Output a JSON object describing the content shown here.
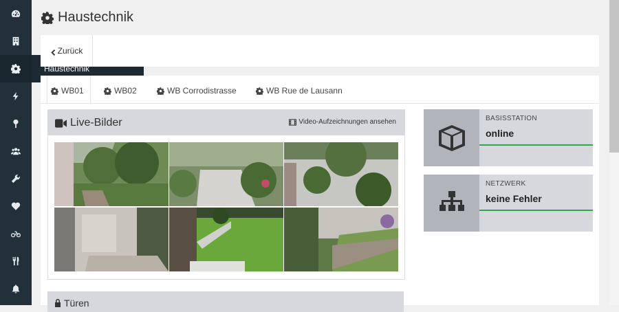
{
  "page": {
    "title": "Haustechnik"
  },
  "sidebar": {
    "items": [
      {
        "icon": "dashboard-icon"
      },
      {
        "icon": "building-icon"
      },
      {
        "icon": "gear-icon",
        "active": true
      },
      {
        "icon": "bolt-icon"
      },
      {
        "icon": "pin-icon"
      },
      {
        "icon": "users-icon"
      },
      {
        "icon": "wrench-icon"
      },
      {
        "icon": "heartbeat-icon"
      },
      {
        "icon": "bicycle-icon"
      },
      {
        "icon": "cutlery-icon"
      },
      {
        "icon": "bell-icon"
      }
    ],
    "flyout_label": "Haustechnik"
  },
  "back": {
    "label": "Zurück"
  },
  "tabs": [
    {
      "label": "WB01",
      "active": true
    },
    {
      "label": "WB02"
    },
    {
      "label": "WB Corrodistrasse"
    },
    {
      "label": "WB Rue de Lausann"
    }
  ],
  "live": {
    "title": "Live-Bilder",
    "link": "Video-Aufzeichnungen ansehen"
  },
  "status_cards": [
    {
      "label": "BASISSTATION",
      "value": "online",
      "icon": "cube-icon"
    },
    {
      "label": "NETZWERK",
      "value": "keine Fehler",
      "icon": "sitemap-icon"
    }
  ],
  "doors": {
    "title": "Türen"
  },
  "colors": {
    "accent_ok": "#2ea84a",
    "sidebar": "#22303a"
  }
}
